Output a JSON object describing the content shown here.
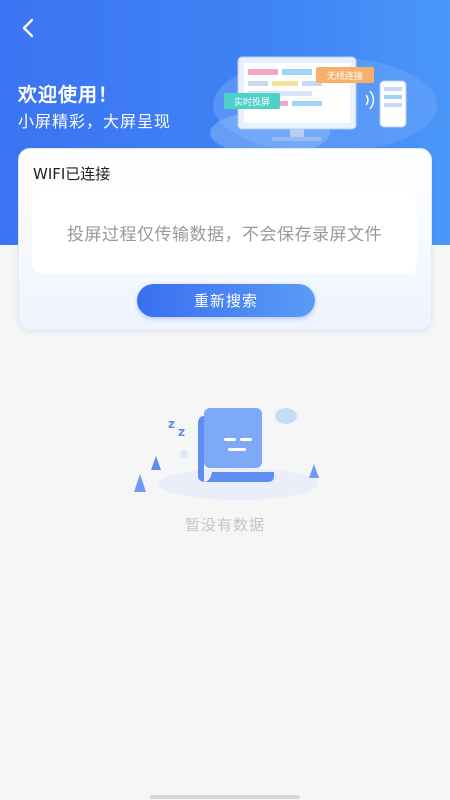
{
  "header": {
    "welcome": "欢迎使用！",
    "slogan": "小屏精彩，大屏呈现",
    "illustration": {
      "tag_realtime": "实时投屏",
      "tag_wireless": "无线连接"
    }
  },
  "connection": {
    "wifi_status": "WIFI已连接",
    "notice": "投屏过程仅传输数据，不会保存录屏文件",
    "research_button": "重新搜索"
  },
  "empty_state": {
    "text": "暂没有数据"
  },
  "colors": {
    "primary": "#3b74f2",
    "button_gradient_end": "#5a9cf7",
    "background": "#f6f6f6"
  },
  "icons": {
    "back": "chevron-left-icon",
    "empty": "sleeping-document-icon"
  }
}
